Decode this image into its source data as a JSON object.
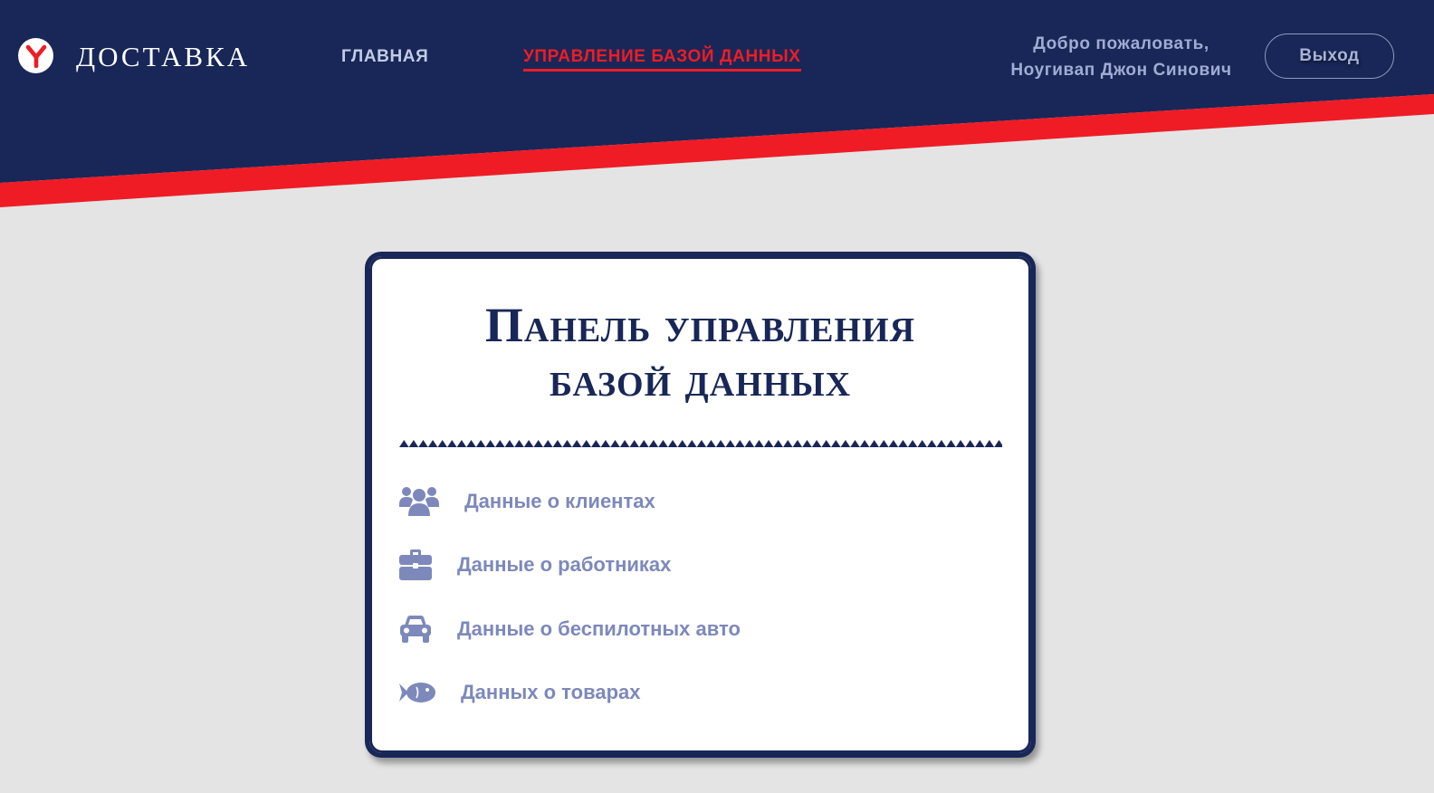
{
  "colors": {
    "navy": "#182757",
    "accent_red": "#ef1c25",
    "background": "#e4e4e4",
    "menu_text": "#7d89bb"
  },
  "header": {
    "logo_icon": "yandex-y-icon",
    "brand": "ДОСТАВКА",
    "nav": {
      "home": "ГЛАВНАЯ",
      "database": "УПРАВЛЕНИЕ БАЗОЙ ДАННЫХ"
    },
    "active_nav": "database",
    "welcome_line1": "Добро пожаловать,",
    "welcome_line2": "Ноугивап Джон Синович",
    "logout": "Выход"
  },
  "panel": {
    "title_line1": "Панель управления",
    "title_line2": "базой данных",
    "items": [
      {
        "icon": "users-icon",
        "label": "Данные о клиентах"
      },
      {
        "icon": "briefcase-icon",
        "label": "Данные о работниках"
      },
      {
        "icon": "car-icon",
        "label": "Данные о беспилотных авто"
      },
      {
        "icon": "fish-icon",
        "label": "Данных о товарах"
      }
    ]
  }
}
